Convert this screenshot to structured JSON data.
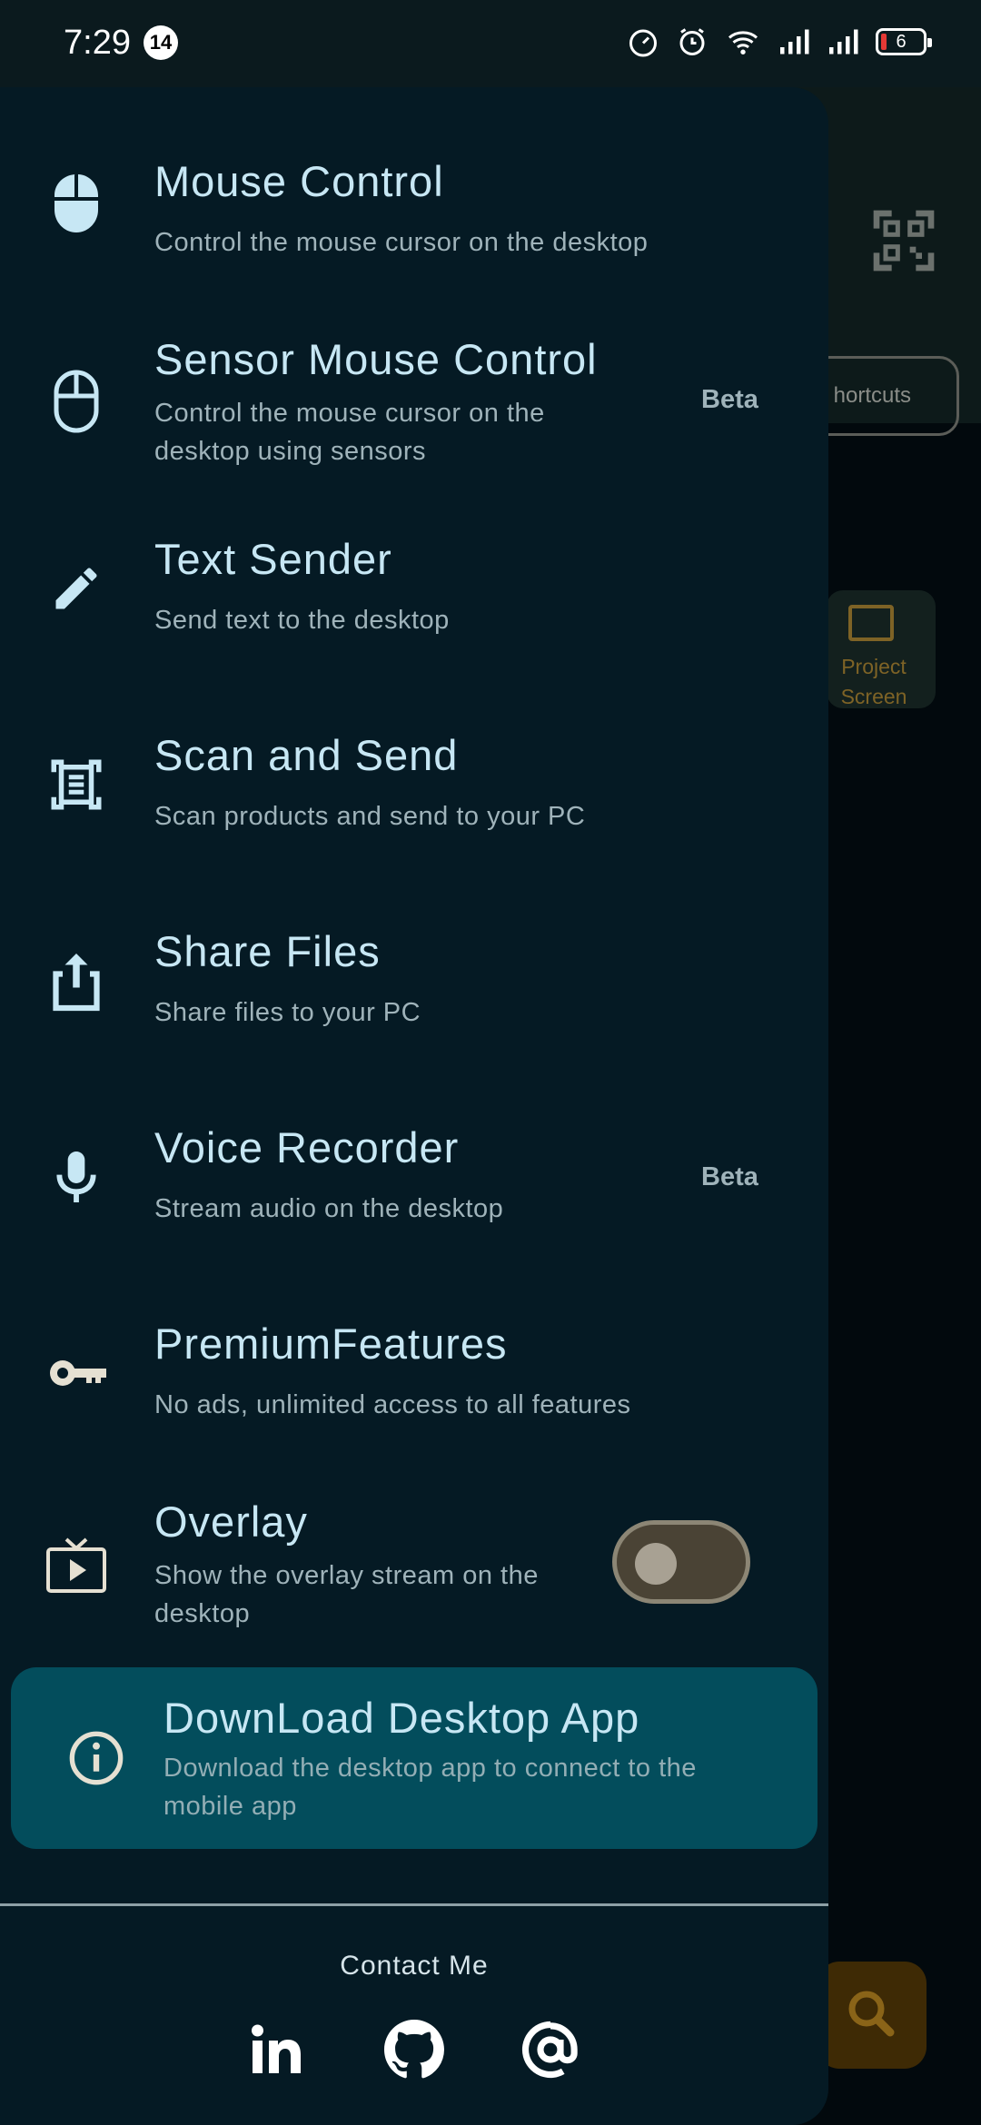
{
  "status_bar": {
    "time": "7:29",
    "notification_count": "14",
    "battery": "6"
  },
  "background": {
    "chip_label": "hortcuts",
    "tile_label": "Project Screen"
  },
  "drawer": {
    "items": [
      {
        "title": "Mouse Control",
        "subtitle": "Control the mouse cursor on the desktop",
        "icon": "mouse-filled-icon"
      },
      {
        "title": "Sensor Mouse Control",
        "subtitle": "Control the mouse cursor on the desktop using sensors",
        "badge": "Beta",
        "icon": "mouse-outline-icon"
      },
      {
        "title": "Text Sender",
        "subtitle": "Send text to the desktop",
        "icon": "pencil-icon"
      },
      {
        "title": "Scan and Send",
        "subtitle": "Scan products and send to your PC",
        "icon": "document-scanner-icon"
      },
      {
        "title": "Share Files",
        "subtitle": "Share files to your PC",
        "icon": "share-upload-icon"
      },
      {
        "title": "Voice Recorder",
        "subtitle": "Stream audio on the desktop",
        "badge": "Beta",
        "icon": "microphone-icon"
      },
      {
        "title": "PremiumFeatures",
        "subtitle": "No ads, unlimited access to all features",
        "icon": "key-icon"
      },
      {
        "title": "Overlay",
        "subtitle": "Show the overlay stream on the desktop",
        "icon": "live-tv-icon",
        "toggle_on": false
      }
    ],
    "download": {
      "title": "DownLoad Desktop App",
      "subtitle": "Download the desktop app to connect to the mobile app",
      "icon": "info-icon"
    },
    "contact_label": "Contact Me",
    "socials": [
      "linkedin-icon",
      "github-icon",
      "email-at-icon"
    ]
  },
  "colors": {
    "drawer_bg": "#051a24",
    "highlight_bg": "#034d5c",
    "accent_text": "#c7e7f4"
  }
}
